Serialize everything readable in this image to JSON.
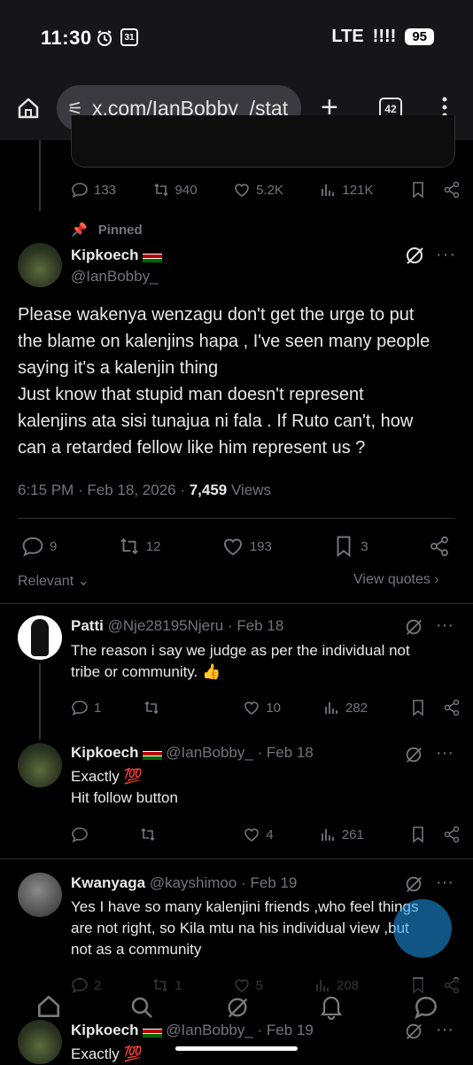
{
  "status": {
    "time": "11:30",
    "calendar": "31",
    "network": "LTE",
    "battery": "95"
  },
  "browser": {
    "url": "x.com/IanBobby_/stat",
    "tabs": "42"
  },
  "prev_tweet": {
    "replies": "133",
    "retweets": "940",
    "likes": "5.2K",
    "views": "121K"
  },
  "main": {
    "pinned_label": "Pinned",
    "name": "Kipkoech",
    "handle": "@IanBobby_",
    "text_lines": [
      "Please wakenya wenzagu don't get the urge to put",
      "the blame on kalenjins hapa , I've seen many people",
      "saying it's a kalenjin thing",
      "Just know that stupid man doesn't represent",
      "kalenjins ata sisi tunajua ni fala . If Ruto can't, how",
      "can a retarded fellow like him represent us ?"
    ],
    "timestamp": "6:15 PM · Feb 18, 2026 · ",
    "views_count": "7,459",
    "views_label": " Views",
    "replies": "9",
    "retweets": "12",
    "likes": "193",
    "bookmarks": "3",
    "sort_label": "Relevant",
    "view_quotes": "View quotes"
  },
  "replies": [
    {
      "name": "Patti",
      "handle": "@Nje28195Njeru · Feb 18",
      "line1": "The reason  i say we judge as per the individual not",
      "line2": "tribe or community. 👍",
      "replies": "1",
      "retweets": "",
      "likes": "10",
      "views": "282"
    },
    {
      "name": "Kipkoech",
      "handle": "@IanBobby_ · Feb 18",
      "line1": "Exactly 💯",
      "line2": "Hit follow button",
      "replies": "",
      "retweets": "",
      "likes": "4",
      "views": "261"
    },
    {
      "name": "Kwanyaga",
      "handle": "@kayshimoo · Feb 19",
      "line1": "Yes I have so many kalenjini friends ,who feel things",
      "line2": "are not right, so Kila mtu na his individual view ,but",
      "line3": "not as a community",
      "replies": "2",
      "retweets": "1",
      "likes": "5",
      "views": "208"
    },
    {
      "name": "Kipkoech",
      "handle": "@IanBobby_ · Feb 19",
      "line1": "Exactly 💯"
    }
  ]
}
